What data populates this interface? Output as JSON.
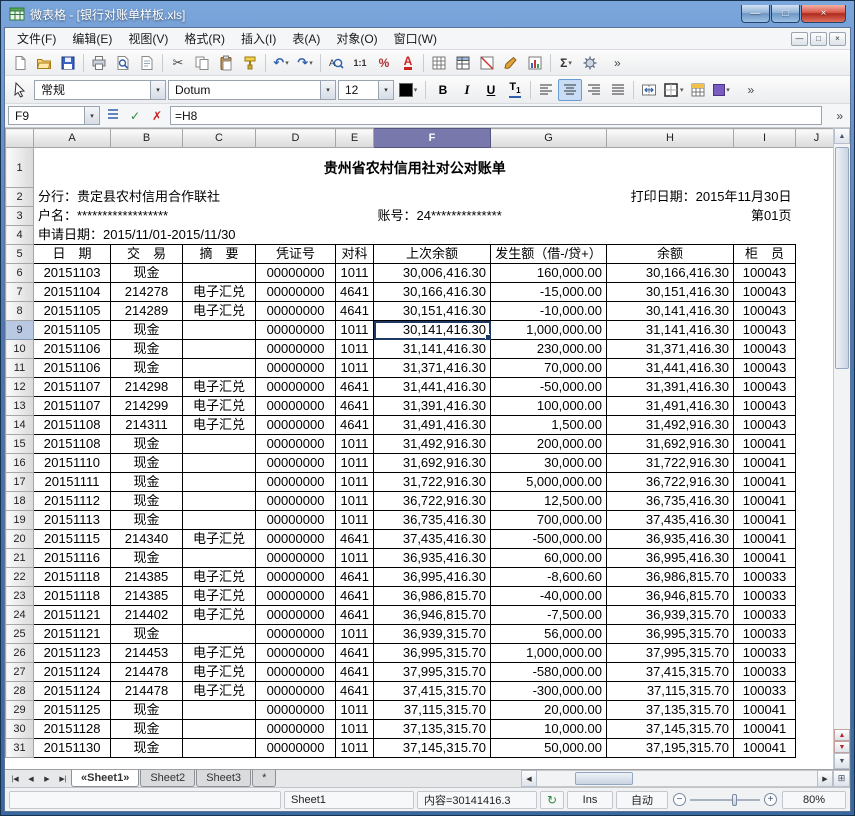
{
  "window": {
    "title": "微表格 - [银行对账单样板.xls]"
  },
  "menu": {
    "items": [
      "文件(F)",
      "编辑(E)",
      "视图(V)",
      "格式(R)",
      "插入(I)",
      "表(A)",
      "对象(O)",
      "窗口(W)"
    ]
  },
  "toolbar": {
    "items": [
      "new-file",
      "open-file",
      "save",
      "|",
      "print",
      "print-preview",
      "page-setup",
      "|",
      "cut",
      "copy",
      "paste",
      "format-painter",
      "|",
      "undo",
      "redo",
      "|",
      "find",
      "zoom-actual",
      "percent",
      "font-color",
      "|",
      "grid-borders",
      "table",
      "diagonal",
      "paint-brush",
      "chart",
      "|",
      "autosum",
      "object-tool"
    ],
    "overflow": "»"
  },
  "format_bar": {
    "number_format": "常规",
    "font_name": "Dotum",
    "font_size": "12",
    "buttons": [
      "bold",
      "italic",
      "underline",
      "font-effects",
      "|",
      "align-left",
      "align-center",
      "align-right",
      "align-justify",
      "|",
      "merge-cells",
      "borders",
      "table-style",
      "fill-color"
    ],
    "pressed": "align-center",
    "overflow": "»",
    "font_color": "#000000",
    "fill_color": "#7b5cc1"
  },
  "formula_bar": {
    "name_box": "F9",
    "formula": "=H8",
    "buttons": [
      "list",
      "confirm",
      "cancel"
    ],
    "overflow": "»"
  },
  "sheet": {
    "columns": [
      "A",
      "B",
      "C",
      "D",
      "E",
      "F",
      "G",
      "H",
      "I",
      "J"
    ],
    "selected_column": "F",
    "selected_row": 9,
    "selected_cell": "F9",
    "doc": {
      "title": "贵州省农村信用社对公对账单",
      "branch": "分行：贵定县农村信用合作联社",
      "print_date": "打印日期：2015年11月30日",
      "account_name": "户名：******************",
      "account_no": "账号：24**************",
      "page_no": "第01页",
      "period": "申请日期：2015/11/01-2015/11/30",
      "table_headers": [
        "日　期",
        "交　易",
        "摘　要",
        "凭证号",
        "对科",
        "上次余额",
        "发生额（借-/贷+）",
        "余额",
        "柜　员"
      ],
      "rows": [
        [
          "20151103",
          "现金",
          "",
          "00000000",
          "1011",
          "30,006,416.30",
          "160,000.00",
          "30,166,416.30",
          "100043"
        ],
        [
          "20151104",
          "214278",
          "电子汇兑",
          "00000000",
          "4641",
          "30,166,416.30",
          "-15,000.00",
          "30,151,416.30",
          "100043"
        ],
        [
          "20151105",
          "214289",
          "电子汇兑",
          "00000000",
          "4641",
          "30,151,416.30",
          "-10,000.00",
          "30,141,416.30",
          "100043"
        ],
        [
          "20151105",
          "现金",
          "",
          "00000000",
          "1011",
          "30,141,416.30",
          "1,000,000.00",
          "31,141,416.30",
          "100043"
        ],
        [
          "20151106",
          "现金",
          "",
          "00000000",
          "1011",
          "31,141,416.30",
          "230,000.00",
          "31,371,416.30",
          "100043"
        ],
        [
          "20151106",
          "现金",
          "",
          "00000000",
          "1011",
          "31,371,416.30",
          "70,000.00",
          "31,441,416.30",
          "100043"
        ],
        [
          "20151107",
          "214298",
          "电子汇兑",
          "00000000",
          "4641",
          "31,441,416.30",
          "-50,000.00",
          "31,391,416.30",
          "100043"
        ],
        [
          "20151107",
          "214299",
          "电子汇兑",
          "00000000",
          "4641",
          "31,391,416.30",
          "100,000.00",
          "31,491,416.30",
          "100043"
        ],
        [
          "20151108",
          "214311",
          "电子汇兑",
          "00000000",
          "4641",
          "31,491,416.30",
          "1,500.00",
          "31,492,916.30",
          "100043"
        ],
        [
          "20151108",
          "现金",
          "",
          "00000000",
          "1011",
          "31,492,916.30",
          "200,000.00",
          "31,692,916.30",
          "100041"
        ],
        [
          "20151110",
          "现金",
          "",
          "00000000",
          "1011",
          "31,692,916.30",
          "30,000.00",
          "31,722,916.30",
          "100041"
        ],
        [
          "20151111",
          "现金",
          "",
          "00000000",
          "1011",
          "31,722,916.30",
          "5,000,000.00",
          "36,722,916.30",
          "100041"
        ],
        [
          "20151112",
          "现金",
          "",
          "00000000",
          "1011",
          "36,722,916.30",
          "12,500.00",
          "36,735,416.30",
          "100041"
        ],
        [
          "20151113",
          "现金",
          "",
          "00000000",
          "1011",
          "36,735,416.30",
          "700,000.00",
          "37,435,416.30",
          "100041"
        ],
        [
          "20151115",
          "214340",
          "电子汇兑",
          "00000000",
          "4641",
          "37,435,416.30",
          "-500,000.00",
          "36,935,416.30",
          "100041"
        ],
        [
          "20151116",
          "现金",
          "",
          "00000000",
          "1011",
          "36,935,416.30",
          "60,000.00",
          "36,995,416.30",
          "100041"
        ],
        [
          "20151118",
          "214385",
          "电子汇兑",
          "00000000",
          "4641",
          "36,995,416.30",
          "-8,600.60",
          "36,986,815.70",
          "100033"
        ],
        [
          "20151118",
          "214385",
          "电子汇兑",
          "00000000",
          "4641",
          "36,986,815.70",
          "-40,000.00",
          "36,946,815.70",
          "100033"
        ],
        [
          "20151121",
          "214402",
          "电子汇兑",
          "00000000",
          "4641",
          "36,946,815.70",
          "-7,500.00",
          "36,939,315.70",
          "100033"
        ],
        [
          "20151121",
          "现金",
          "",
          "00000000",
          "1011",
          "36,939,315.70",
          "56,000.00",
          "36,995,315.70",
          "100033"
        ],
        [
          "20151123",
          "214453",
          "电子汇兑",
          "00000000",
          "4641",
          "36,995,315.70",
          "1,000,000.00",
          "37,995,315.70",
          "100033"
        ],
        [
          "20151124",
          "214478",
          "电子汇兑",
          "00000000",
          "4641",
          "37,995,315.70",
          "-580,000.00",
          "37,415,315.70",
          "100033"
        ],
        [
          "20151124",
          "214478",
          "电子汇兑",
          "00000000",
          "4641",
          "37,415,315.70",
          "-300,000.00",
          "37,115,315.70",
          "100033"
        ],
        [
          "20151125",
          "现金",
          "",
          "00000000",
          "1011",
          "37,115,315.70",
          "20,000.00",
          "37,135,315.70",
          "100041"
        ],
        [
          "20151128",
          "现金",
          "",
          "00000000",
          "1011",
          "37,135,315.70",
          "10,000.00",
          "37,145,315.70",
          "100041"
        ],
        [
          "20151130",
          "现金",
          "",
          "00000000",
          "1011",
          "37,145,315.70",
          "50,000.00",
          "37,195,315.70",
          "100041"
        ]
      ]
    }
  },
  "sheet_tabs": {
    "tabs": [
      {
        "label": "«Sheet1»",
        "active": true
      },
      {
        "label": "Sheet2",
        "active": false
      },
      {
        "label": "Sheet3",
        "active": false
      },
      {
        "label": "*",
        "active": false
      }
    ]
  },
  "status_bar": {
    "sheet": "Sheet1",
    "content": "内容=30141416.3",
    "ins": "Ins",
    "mode": "自动",
    "zoom": "80%"
  },
  "icons": {
    "minimize": "—",
    "maximize": "□",
    "close": "×",
    "dropdown": "▾",
    "first_sheet": "|◀",
    "prev_sheet": "◀",
    "next_sheet": "▶",
    "last_sheet": "▶|",
    "scroll_left": "◀",
    "scroll_right": "▶",
    "scroll_up": "▲",
    "scroll_down": "▼",
    "red_up": "▲",
    "red_down": "▼",
    "split_box": "⊞",
    "recalc": "↻",
    "zoom_out": "−",
    "zoom_in": "+"
  }
}
